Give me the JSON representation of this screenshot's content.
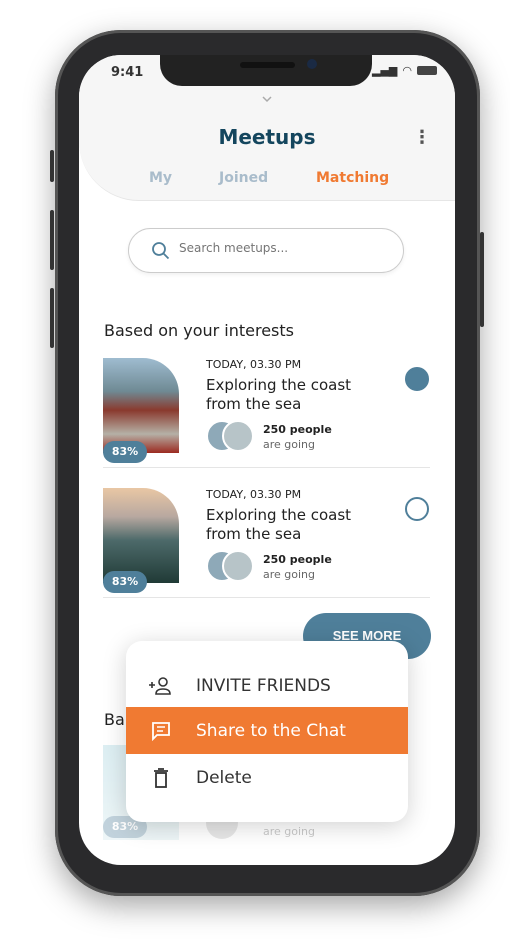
{
  "status_bar": {
    "time": "9:41"
  },
  "header": {
    "title": "Meetups",
    "tabs": [
      {
        "label": "My"
      },
      {
        "label": "Joined"
      },
      {
        "label": "Matching",
        "active": true
      }
    ]
  },
  "search": {
    "placeholder": "Search meetups..."
  },
  "sections": [
    {
      "title": "Based on your interests",
      "items": [
        {
          "date": "TODAY, 03.30 PM",
          "name": "Exploring the coast from the sea",
          "match": "83%",
          "people": "250 people",
          "going": "are going",
          "selected": true
        },
        {
          "date": "TODAY, 03.30 PM",
          "name": "Exploring the coast from the sea",
          "match": "83%",
          "people": "250 people",
          "going": "are going",
          "selected": false
        }
      ]
    },
    {
      "title": "Ba",
      "items": [
        {
          "match": "83%",
          "going": "are going"
        }
      ]
    }
  ],
  "see_more": "SEE MORE",
  "context_menu": {
    "items": [
      {
        "label": "INVITE FRIENDS",
        "icon": "add-person-icon"
      },
      {
        "label": "Share to the Chat",
        "icon": "chat-icon",
        "highlighted": true
      },
      {
        "label": "Delete",
        "icon": "trash-icon"
      }
    ]
  },
  "colors": {
    "accent": "#f07a32",
    "primary": "#4f7f9a",
    "title": "#14465e",
    "tab_inactive": "#a9bccb"
  }
}
